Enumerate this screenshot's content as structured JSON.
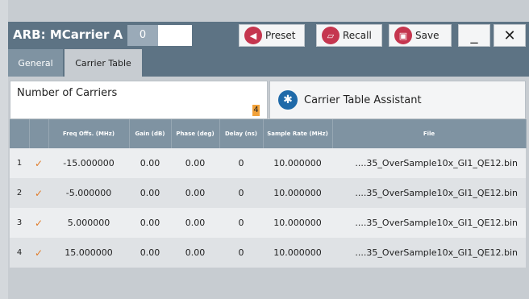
{
  "window": {
    "title": "ARB: MCarrier A",
    "instance_value": "0",
    "buttons": {
      "preset": "Preset",
      "recall": "Recall",
      "save": "Save"
    },
    "minimize_glyph": "_",
    "close_glyph": "✕"
  },
  "tabs": [
    {
      "label": "General"
    },
    {
      "label": "Carrier Table"
    }
  ],
  "params": {
    "number_of_carriers_label": "Number of Carriers",
    "number_of_carriers_value": "4",
    "assistant_label": "Carrier Table Assistant"
  },
  "table": {
    "headers": [
      "",
      "",
      "Freq Offs. (MHz)",
      "Gain (dB)",
      "Phase (deg)",
      "Delay (ns)",
      "Sample Rate (MHz)",
      "File"
    ],
    "rows": [
      {
        "n": "1",
        "freq": "-15.000000",
        "gain": "0.00",
        "phase": "0.00",
        "delay": "0",
        "rate": "10.000000",
        "file": "....35_OverSample10x_GI1_QE12.bin"
      },
      {
        "n": "2",
        "freq": "-5.000000",
        "gain": "0.00",
        "phase": "0.00",
        "delay": "0",
        "rate": "10.000000",
        "file": "....35_OverSample10x_GI1_QE12.bin"
      },
      {
        "n": "3",
        "freq": "5.000000",
        "gain": "0.00",
        "phase": "0.00",
        "delay": "0",
        "rate": "10.000000",
        "file": "....35_OverSample10x_GI1_QE12.bin"
      },
      {
        "n": "4",
        "freq": "15.000000",
        "gain": "0.00",
        "phase": "0.00",
        "delay": "0",
        "rate": "10.000000",
        "file": "....35_OverSample10x_GI1_QE12.bin"
      }
    ]
  },
  "colors": {
    "header_bg": "#5d7384",
    "accent_orange": "#e07b28",
    "icon_red": "#c5364f",
    "icon_blue": "#1f6aa9"
  }
}
